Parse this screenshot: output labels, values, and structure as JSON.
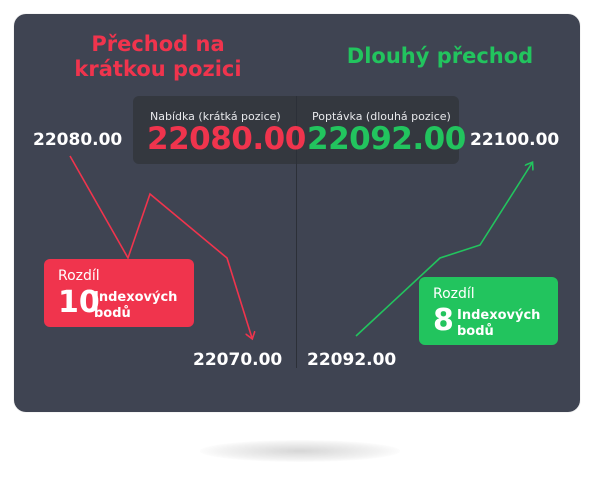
{
  "colors": {
    "short": "#f0344d",
    "long": "#22c45e",
    "card": "#3f4452",
    "quote_box": "#34383f",
    "text": "#ffffff"
  },
  "headings": {
    "short_line1": "Přechod na",
    "short_line2": "krátkou pozici",
    "long": "Dlouhý přechod"
  },
  "quotes": {
    "bid_label": "Nabídka (krátká pozice)",
    "bid_value": "22080.00",
    "ask_label": "Poptávka (dlouhá pozice)",
    "ask_value": "22092.00"
  },
  "prices": {
    "short_start": "22080.00",
    "short_end": "22070.00",
    "long_start": "22092.00",
    "long_end": "22100.00"
  },
  "badges": {
    "short": {
      "title": "Rozdíl",
      "number": "10",
      "unit": "Indexových bodů"
    },
    "long": {
      "title": "Rozdíl",
      "number": "8",
      "unit": "Indexových bodů"
    }
  }
}
